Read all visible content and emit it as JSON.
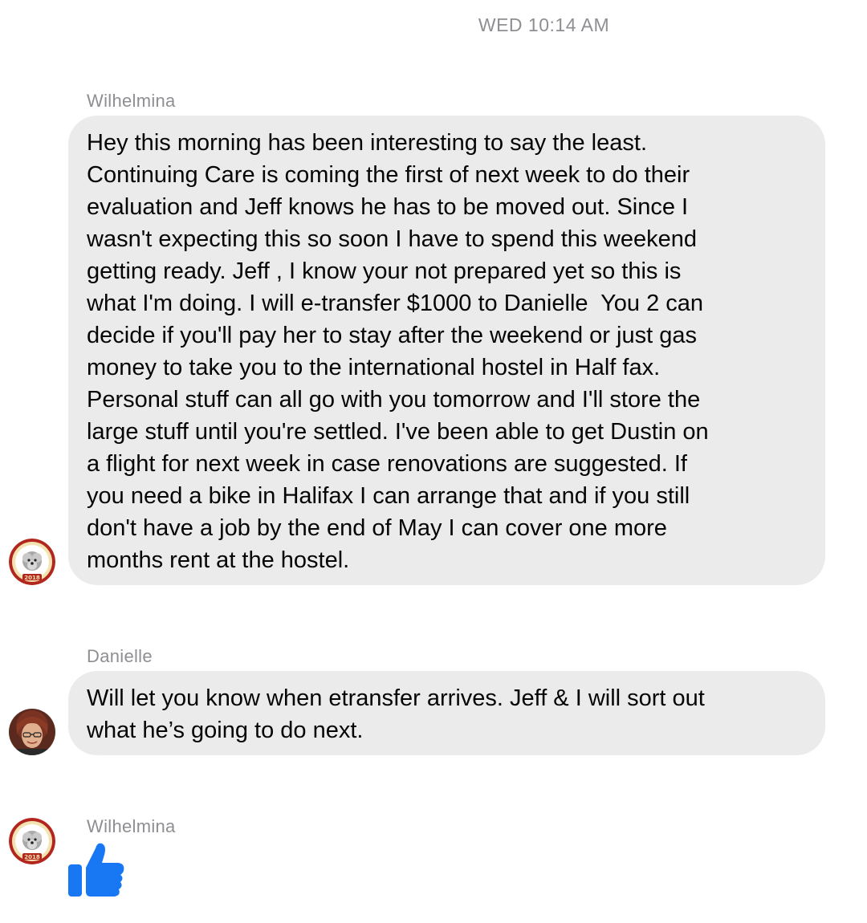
{
  "timestamp": "WED 10:14 AM",
  "messages": [
    {
      "sender": "Wilhelmina",
      "lines": [
        "Hey this morning has been interesting to say the least.",
        "Continuing Care is coming the first of next week to do their",
        "evaluation and Jeff knows he has to be moved out. Since I",
        "wasn't expecting this so soon I have to spend this weekend",
        "getting ready. Jeff , I know your not prepared yet so this is",
        "what I'm doing. I will e-transfer $1000 to Danielle  You 2 can",
        "decide if you'll pay her to stay after the weekend or just gas",
        "money to take you to the international hostel in Half fax.",
        "Personal stuff can all go with you tomorrow and I'll store the",
        "large stuff until you're settled. I've been able to get Dustin on",
        "a flight for next week in case renovations are suggested. If",
        "you need a bike in Halifax I can arrange that and if you still",
        "don't have a job by the end of May I can cover one more",
        "months rent at the hostel."
      ],
      "avatar_badge": "2018"
    },
    {
      "sender": "Danielle",
      "lines": [
        "Will let you know when etransfer arrives. Jeff & I will sort out",
        "what he’s going to do next."
      ]
    },
    {
      "sender": "Wilhelmina",
      "reaction_icon": "thumbs-up-icon",
      "avatar_badge": "2018"
    }
  ],
  "colors": {
    "bubble": "#ebebeb",
    "meta_text": "#8e8e93",
    "like_blue": "#1877f2"
  }
}
